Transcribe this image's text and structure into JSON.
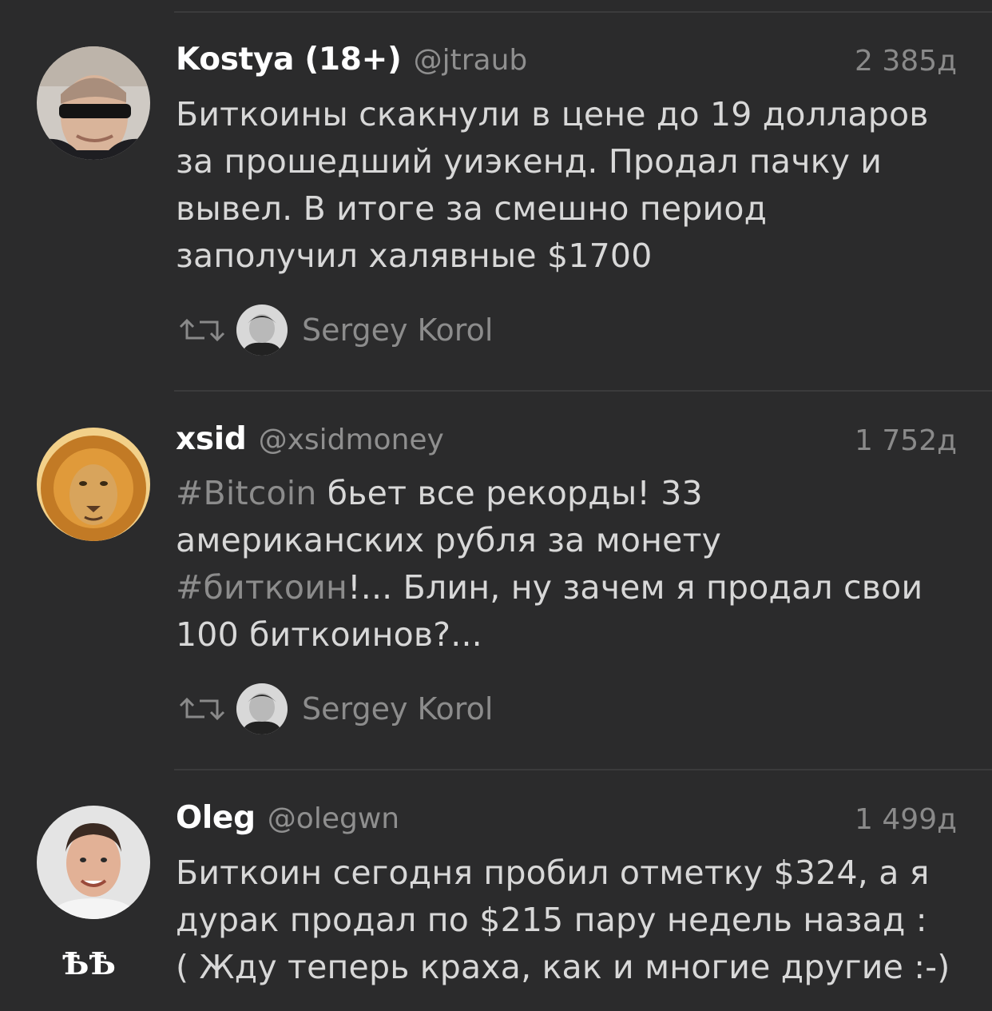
{
  "tweets": [
    {
      "name": "Kostya (18+)",
      "handle": "@jtraub",
      "time": "2 385д",
      "lines": [
        "Биткоины скакнули в цене до 19 долларов",
        "за прошедший уиэкенд. Продал пачку и",
        "вывел. В итоге за смешно период",
        "заполучил халявные $1700"
      ],
      "retweeted_by": "Sergey Korol",
      "avatar_icon": "sunglasses-portrait-avatar"
    },
    {
      "name": "xsid",
      "handle": "@xsidmoney",
      "time": "1 752д",
      "line1_hashtag": "#Bitcoin",
      "line1_rest": " бьет все рекорды! 33",
      "line2": "американских рубля за монету",
      "line3_hashtag": "#биткоин",
      "line3_rest": "!...  Блин, ну зачем я продал свои",
      "line4": "100 биткоинов?...",
      "retweeted_by": "Sergey Korol",
      "avatar_icon": "lion-avatar"
    },
    {
      "name": "Oleg",
      "handle": "@olegwn",
      "time": "1 499д",
      "lines": [
        "Биткоин сегодня пробил отметку $324, а я",
        "дурак продал по $215 пару недель назад :",
        "( Жду теперь краха, как и многие другие :-)"
      ],
      "flair": "ѢѢ",
      "avatar_icon": "smiling-man-avatar"
    }
  ],
  "colors": {
    "background": "#2b2b2c",
    "name": "#ffffff",
    "text": "#d8d8d8",
    "muted": "#8c8c8c"
  }
}
